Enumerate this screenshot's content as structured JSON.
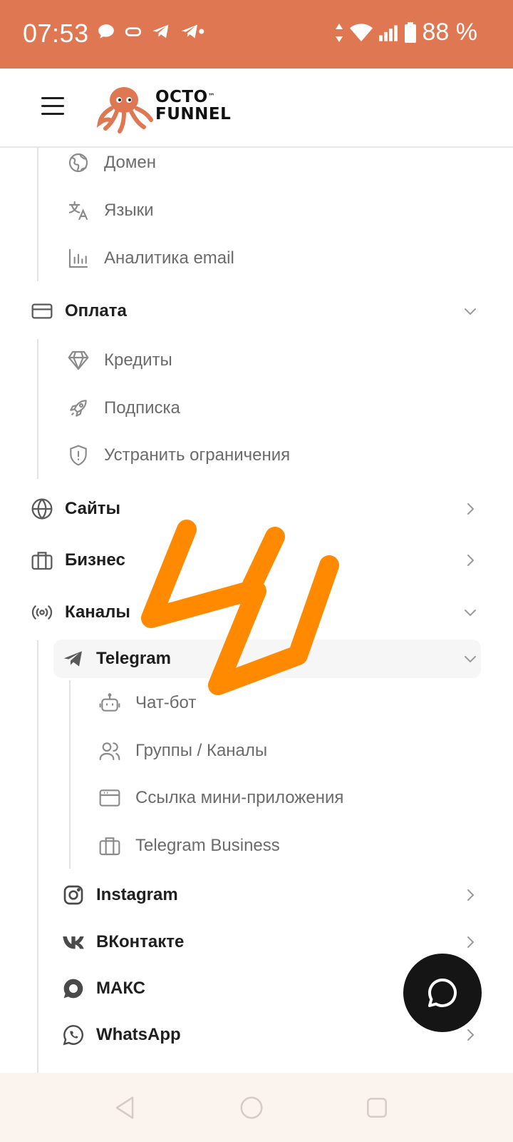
{
  "status_bar": {
    "time": "07:53",
    "notifications": [
      "chat-bubble-icon",
      "pill-icon",
      "telegram-icon",
      "telegram-alt-icon"
    ],
    "battery": "88 %",
    "system_icons": [
      "data-arrows-icon",
      "wifi-icon",
      "signal-icon",
      "battery-icon"
    ]
  },
  "header": {
    "logo_line1": "OCTO",
    "logo_tm": "™",
    "logo_line2": "FUNNEL",
    "brand_color": "#de7752"
  },
  "menu": {
    "domain": "Домен",
    "languages": "Языки",
    "email_analytics": "Аналитика email",
    "payment": "Оплата",
    "credits": "Кредиты",
    "subscription": "Подписка",
    "remove_limits": "Устранить ограничения",
    "sites": "Сайты",
    "business": "Бизнес",
    "channels": "Каналы",
    "telegram": "Telegram",
    "chatbot": "Чат-бот",
    "groups_channels": "Группы / Каналы",
    "mini_app_link": "Ссылка мини-приложения",
    "telegram_business": "Telegram Business",
    "instagram": "Instagram",
    "vkontakte": "ВКонтакте",
    "max": "МАКС",
    "whatsapp": "WhatsApp"
  },
  "colors": {
    "annotation_orange": "#ff8a00",
    "fab": "#151515"
  }
}
